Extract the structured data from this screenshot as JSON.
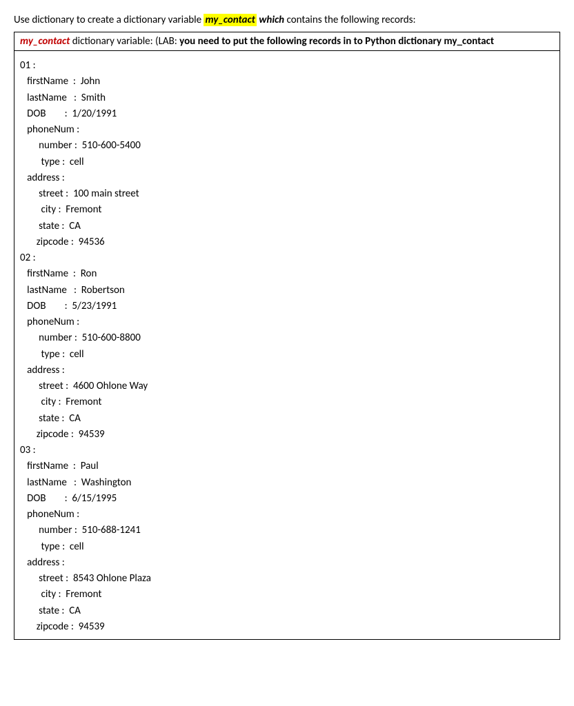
{
  "intro": {
    "prefix": "Use dictionary to create a dictionary variable  ",
    "var_name": "my_contact",
    "middle": " which",
    "suffix": " contains the following records:"
  },
  "header": {
    "var_name": "my_contact",
    "after_var": " dictionary variable:  (LAB: ",
    "bold_part": "you need to put the following records in to Python dictionary my_contact"
  },
  "records": [
    {
      "id": "01",
      "firstName": "John",
      "lastName": "Smith",
      "DOB": "1/20/1991",
      "phoneNum": {
        "number": "510-600-5400",
        "type": "cell"
      },
      "address": {
        "street": "100 main street",
        "city": "Fremont",
        "state": "CA",
        "zipcode": "94536"
      }
    },
    {
      "id": "02",
      "firstName": "Ron",
      "lastName": "Robertson",
      "DOB": "5/23/1991",
      "phoneNum": {
        "number": "510-600-8800",
        "type": "cell"
      },
      "address": {
        "street": "4600 Ohlone Way",
        "city": "Fremont",
        "state": "CA",
        "zipcode": "94539"
      }
    },
    {
      "id": "03",
      "firstName": "Paul",
      "lastName": "Washington",
      "DOB": "6/15/1995",
      "phoneNum": {
        "number": "510-688-1241",
        "type": "cell"
      },
      "address": {
        "street": "8543 Ohlone Plaza",
        "city": "Fremont",
        "state": "CA",
        "zipcode": "94539"
      }
    }
  ],
  "labels": {
    "firstName": "firstName",
    "lastName": "lastName",
    "DOB": "DOB",
    "phoneNum": "phoneNum",
    "number": "number",
    "type": "type",
    "address": "address",
    "street": "street",
    "city": "city",
    "state": "state",
    "zipcode": "zipcode"
  }
}
